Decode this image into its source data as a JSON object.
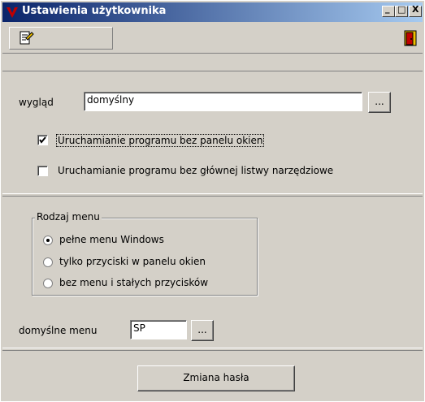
{
  "window": {
    "title": "Ustawienia użytkownika",
    "min_glyph": "_",
    "max_glyph": "□",
    "close_glyph": "X"
  },
  "general": {
    "appearance_label": "wygląd",
    "appearance_value": "domyślny",
    "browse_label": "...",
    "option_no_window_panel": {
      "label": "Uruchamianie programu bez panelu okien",
      "checked": true
    },
    "option_no_main_toolbar": {
      "label": "Uruchamianie programu bez głównej listwy narzędziowe",
      "checked": false
    }
  },
  "menu_type": {
    "group_label": "Rodzaj menu",
    "options": [
      {
        "label": "pełne menu Windows",
        "selected": true
      },
      {
        "label": "tylko przyciski w panelu okien",
        "selected": false
      },
      {
        "label": "bez menu i stałych przycisków",
        "selected": false
      }
    ],
    "default_menu_label": "domyślne menu",
    "default_menu_value": "SP",
    "browse_label": "..."
  },
  "footer": {
    "change_password_label": "Zmiana hasła"
  }
}
